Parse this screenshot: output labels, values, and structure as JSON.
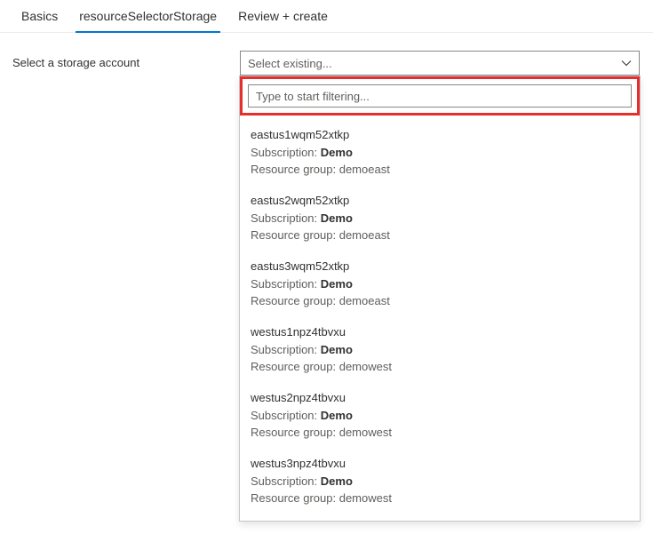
{
  "tabs": [
    {
      "label": "Basics",
      "active": false
    },
    {
      "label": "resourceSelectorStorage",
      "active": true
    },
    {
      "label": "Review + create",
      "active": false
    }
  ],
  "form": {
    "label": "Select a storage account",
    "placeholder": "Select existing...",
    "filter_placeholder": "Type to start filtering...",
    "subscription_label": "Subscription:",
    "resource_group_label": "Resource group:"
  },
  "options": [
    {
      "name": "eastus1wqm52xtkp",
      "subscription": "Demo",
      "resource_group": "demoeast"
    },
    {
      "name": "eastus2wqm52xtkp",
      "subscription": "Demo",
      "resource_group": "demoeast"
    },
    {
      "name": "eastus3wqm52xtkp",
      "subscription": "Demo",
      "resource_group": "demoeast"
    },
    {
      "name": "westus1npz4tbvxu",
      "subscription": "Demo",
      "resource_group": "demowest"
    },
    {
      "name": "westus2npz4tbvxu",
      "subscription": "Demo",
      "resource_group": "demowest"
    },
    {
      "name": "westus3npz4tbvxu",
      "subscription": "Demo",
      "resource_group": "demowest"
    }
  ]
}
